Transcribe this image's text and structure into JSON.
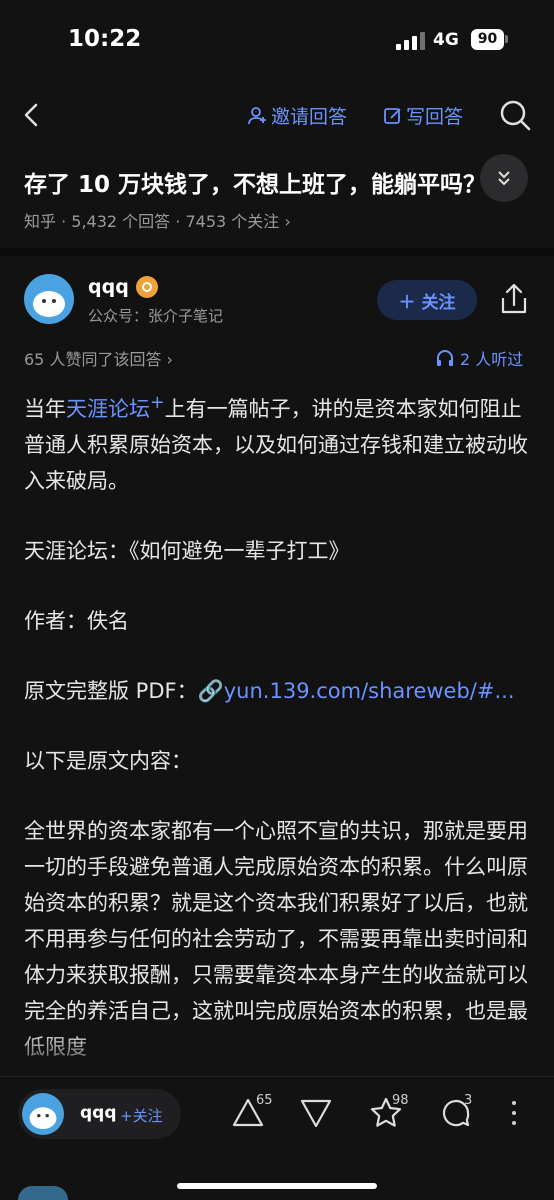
{
  "status": {
    "time": "10:22",
    "network": "4G",
    "battery": "90"
  },
  "nav": {
    "invite_label": "邀请回答",
    "write_label": "写回答"
  },
  "question": {
    "title": "存了 10 万块钱了，不想上班了，能躺平吗？",
    "source": "知乎",
    "answers": "5,432 个回答",
    "followers": "7453 个关注"
  },
  "author": {
    "name": "qqq",
    "subtitle": "公众号：张介子笔记",
    "follow_label": "关注"
  },
  "stats": {
    "votes_text": "65 人赞同了该回答",
    "listen_text": "2 人听过"
  },
  "content": {
    "p1_pre": "当年",
    "p1_link": "天涯论坛",
    "p1_post": "上有一篇帖子，讲的是资本家如何阻止普通人积累原始资本，以及如何通过存钱和建立被动收入来破局。",
    "p2": "天涯论坛：《如何避免一辈子打工》",
    "p3": "作者：佚名",
    "p4_label": "原文完整版 PDF：",
    "p4_link": "yun.139.com/shareweb/#...",
    "p5": "以下是原文内容：",
    "p6": "全世界的资本家都有一个心照不宣的共识，那就是要用一切的手段避免普通人完成原始资本的积累。什么叫原始资本的积累？就是这个资本我们积累好了以后，也就不用再参与任何的社会劳动了，不需要再靠出卖时间和体力来获取报酬，只需要靠资本本身产生的收益就可以完全的养活自己，这就叫完成原始资本的积累，也是最低限度"
  },
  "bottom": {
    "name": "qqq",
    "follow_label": "+关注",
    "upvote_count": "65",
    "star_count": "98",
    "comment_count": "3"
  },
  "colors": {
    "accent": "#6a93ff",
    "background": "#121212"
  },
  "icons": [
    "back-icon",
    "invite-icon",
    "write-icon",
    "search-icon",
    "chevron-down-icon",
    "share-icon",
    "headphones-icon",
    "upvote-icon",
    "downvote-icon",
    "star-icon",
    "comment-icon",
    "more-icon"
  ]
}
